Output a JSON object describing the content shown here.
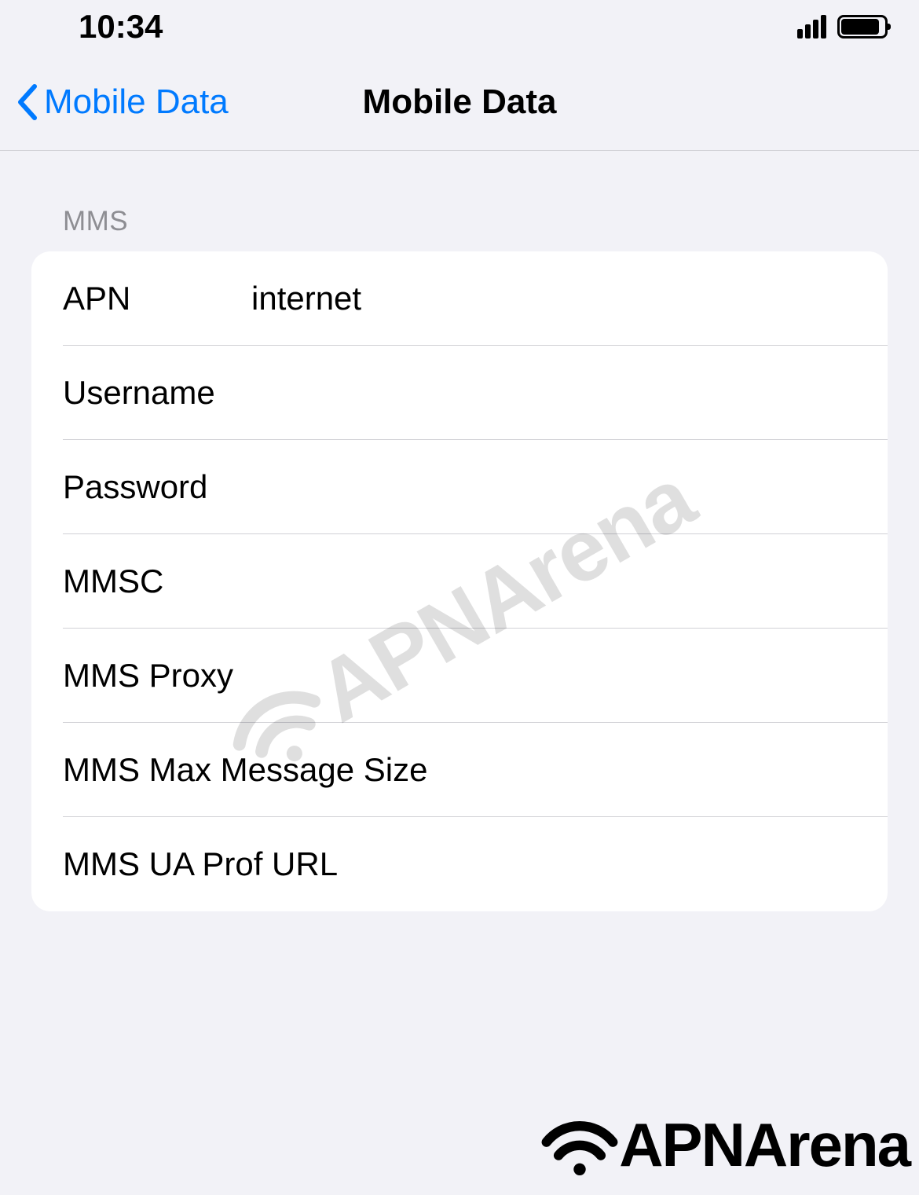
{
  "status_bar": {
    "time": "10:34"
  },
  "nav": {
    "back_label": "Mobile Data",
    "title": "Mobile Data"
  },
  "section": {
    "header": "MMS",
    "rows": [
      {
        "label": "APN",
        "value": "internet"
      },
      {
        "label": "Username",
        "value": ""
      },
      {
        "label": "Password",
        "value": ""
      },
      {
        "label": "MMSC",
        "value": ""
      },
      {
        "label": "MMS Proxy",
        "value": ""
      },
      {
        "label": "MMS Max Message Size",
        "value": ""
      },
      {
        "label": "MMS UA Prof URL",
        "value": ""
      }
    ]
  },
  "watermark": {
    "text": "APNArena"
  },
  "footer": {
    "text": "APNArena"
  }
}
